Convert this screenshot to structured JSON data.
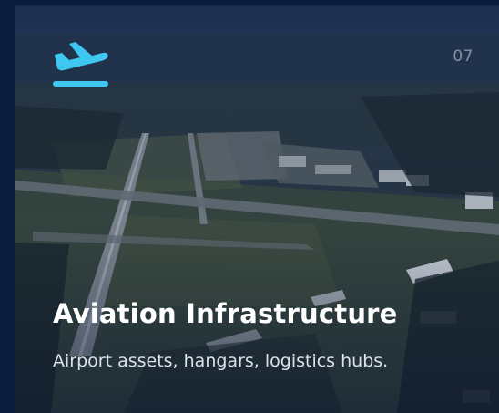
{
  "card": {
    "index": "07",
    "title": "Aviation Infrastructure",
    "subtitle": "Airport assets, hangars, logistics hubs.",
    "icon": "airplane-departure-icon",
    "accent_color": "#3ec7f0",
    "frame_color": "#0b1c3d"
  }
}
